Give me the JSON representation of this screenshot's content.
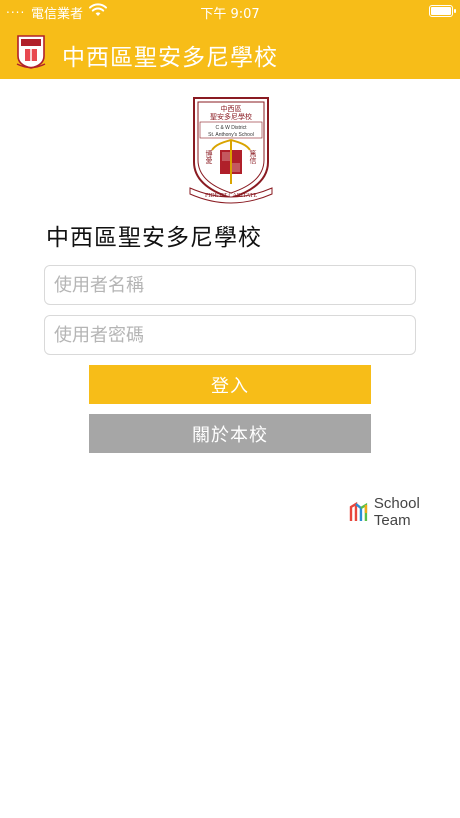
{
  "status_bar": {
    "signal": "....",
    "carrier": "電信業者",
    "time": "下午 9:07",
    "icons": [
      "wifi-icon",
      "battery-icon"
    ]
  },
  "nav": {
    "title": "中西區聖安多尼學校",
    "logo_icon": "school-crest-icon"
  },
  "crest": {
    "top_text": "中西區",
    "sub_text": "聖安多尼學校",
    "line1": "C & W District",
    "line2": "St. Anthony's School",
    "motto": "FIDE ET CARITATE",
    "left_chars": "博愛",
    "right_chars": "篤信"
  },
  "login": {
    "school_name": "中西區聖安多尼學校",
    "username_placeholder": "使用者名稱",
    "password_placeholder": "使用者密碼",
    "login_label": "登入",
    "about_label": "關於本校"
  },
  "footer": {
    "brand_name": "School Team",
    "brand_icon": "schoolteam-logo-icon"
  },
  "colors": {
    "accent": "#f7bd18",
    "secondary_button": "#a6a6a6",
    "crest_red": "#b0202a"
  }
}
